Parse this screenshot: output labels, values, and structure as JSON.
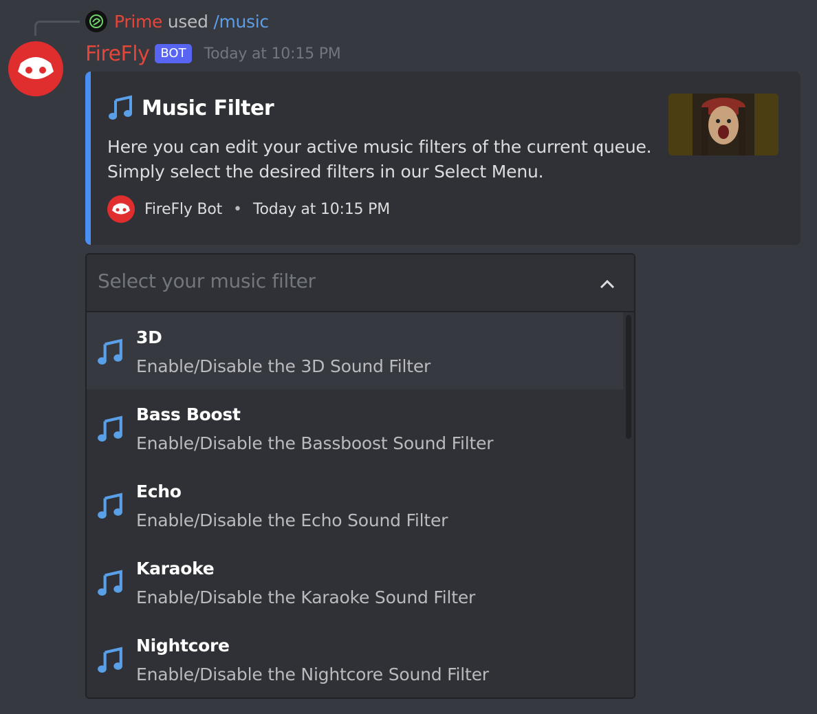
{
  "reply": {
    "user": "Prime",
    "used": " used ",
    "command": "/music"
  },
  "message": {
    "username": "FireFly",
    "bot_tag": "BOT",
    "timestamp": "Today at 10:15 PM"
  },
  "embed": {
    "accent_color": "#4a8ff5",
    "title_icon": "music-note-icon",
    "title": "Music Filter",
    "description_line1": "Here you can edit your active music filters of the current queue.",
    "description_line2": "Simply select the desired filters in our Select Menu.",
    "footer_name": "FireFly Bot",
    "footer_separator": "•",
    "footer_timestamp": "Today at 10:15 PM"
  },
  "select_menu": {
    "placeholder": "Select your music filter",
    "options": [
      {
        "label": "3D",
        "description": "Enable/Disable the 3D Sound Filter"
      },
      {
        "label": "Bass Boost",
        "description": "Enable/Disable the Bassboost Sound Filter"
      },
      {
        "label": "Echo",
        "description": "Enable/Disable the Echo Sound Filter"
      },
      {
        "label": "Karaoke",
        "description": "Enable/Disable the Karaoke Sound Filter"
      },
      {
        "label": "Nightcore",
        "description": "Enable/Disable the Nightcore Sound Filter"
      }
    ]
  },
  "colors": {
    "username": "#e6453a",
    "bot_tag": "#5865f2",
    "command": "#5d9ee6",
    "avatar_bg": "#e02e2e"
  }
}
